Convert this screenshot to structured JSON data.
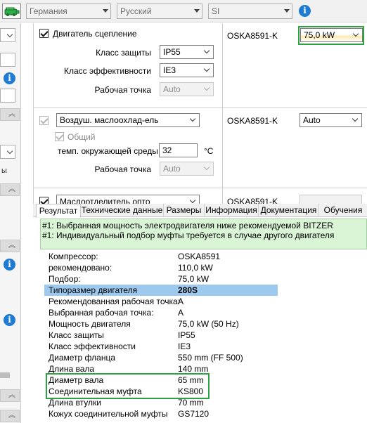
{
  "toolbar": {
    "country": "Германия",
    "language": "Русский",
    "units": "SI"
  },
  "left_strip": {
    "truncated_text": "ы"
  },
  "motor": {
    "label": "Двигатель сцепление",
    "protection_label": "Класс защиты",
    "protection_value": "IP55",
    "efficiency_label": "Класс эффективности",
    "efficiency_value": "IE3",
    "operating_point_label": "Рабочая точка",
    "operating_point_value": "Auto",
    "compressor": "OSKA8591-K",
    "power_value": "75,0 kW"
  },
  "oil_cooler": {
    "type_value": "Воздуш. маслоохлад-ель",
    "common_label": "Общий",
    "ambient_temp_label": "темп. окружающей среды",
    "ambient_temp_value": "32",
    "ambient_temp_unit": "°C",
    "operating_point_label": "Рабочая точка",
    "operating_point_value": "Auto",
    "compressor": "OSKA8591-K",
    "mode_value": "Auto"
  },
  "third_row": {
    "label_partial": "Маслоотделитель опто",
    "compressor_partial": "OSKA8591-K"
  },
  "tabs": [
    {
      "label": "Результат"
    },
    {
      "label": "Технические данные"
    },
    {
      "label": "Размеры"
    },
    {
      "label": "Информация"
    },
    {
      "label": "Документация"
    },
    {
      "label": "Обучения"
    }
  ],
  "messages": [
    "#1: Выбранная мощность электродвигателя ниже рекомендуемой BITZER",
    "#1: Индивидуальный подбор муфты требуется в случае другого двигателя"
  ],
  "results": [
    {
      "key": "Компрессор:",
      "value": "OSKA8591"
    },
    {
      "key": "рекомендовано:",
      "value": "110,0 kW"
    },
    {
      "key": "Подбор:",
      "value": "75,0 kW"
    },
    {
      "key": "Типоразмер двигателя",
      "value": "280S"
    },
    {
      "key": "Рекомендованная рабочая точка:",
      "value": "A"
    },
    {
      "key": "Выбранная рабочая точка:",
      "value": "A"
    },
    {
      "key": "Мощность двигателя",
      "value": "75,0 kW (50 Hz)"
    },
    {
      "key": "Класс защиты",
      "value": "IP55"
    },
    {
      "key": "Класс эффективности",
      "value": "IE3"
    },
    {
      "key": "Диаметр фланца",
      "value": "550 mm (FF 500)"
    },
    {
      "key": "Длина вала",
      "value": "140 mm"
    },
    {
      "key": "Диаметр вала",
      "value": "65 mm"
    },
    {
      "key": "Соединительная муфта",
      "value": "KS800"
    },
    {
      "key": "Длина втулки",
      "value": "70 mm"
    },
    {
      "key": "Кожух соединительной муфты",
      "value": "GS7120"
    }
  ],
  "colors": {
    "highlight_row": "#9ec9ef",
    "message_bg": "#d9f5d6",
    "annotation_green": "#2ea043",
    "info_blue": "#1f7ad1"
  },
  "icons": {
    "logo": "compressor-logo-icon",
    "info": "info-icon",
    "collapse": "double-chevron-up-icon"
  }
}
